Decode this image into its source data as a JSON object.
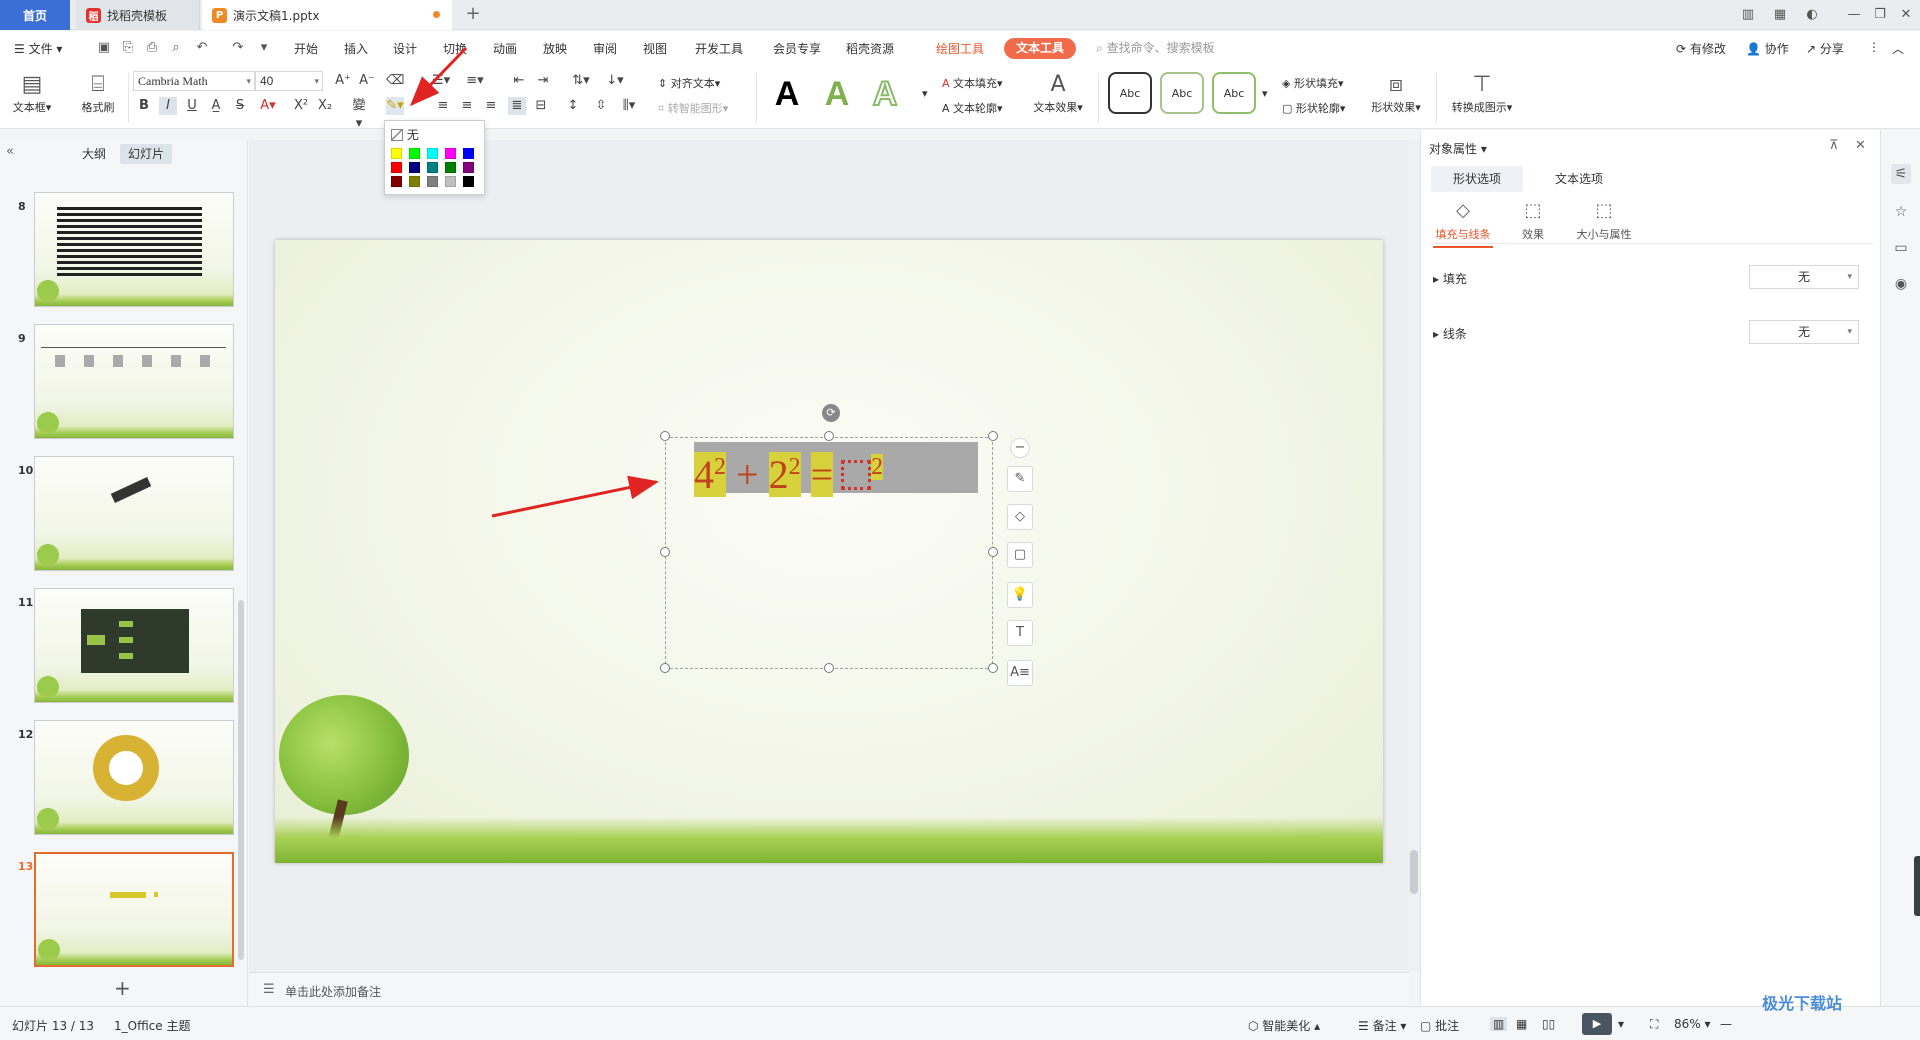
{
  "tabs": {
    "home": "首页",
    "template": "找稻壳模板",
    "doc": "演示文稿1.pptx"
  },
  "menu": {
    "file": "文件",
    "items": [
      "开始",
      "插入",
      "设计",
      "切换",
      "动画",
      "放映",
      "审阅",
      "视图",
      "开发工具",
      "会员专享",
      "稻壳资源"
    ],
    "drawing_tools": "绘图工具",
    "text_tools": "文本工具",
    "search_placeholder": "查找命令、搜索模板",
    "modified": "有修改",
    "collaborate": "协作",
    "share": "分享"
  },
  "ribbon": {
    "textbox": "文本框",
    "format_painter": "格式刷",
    "font_name": "Cambria Math",
    "font_size": "40",
    "align_text": "对齐文本",
    "smart_shape": "转智能图形",
    "text_fill": "文本填充",
    "text_outline": "文本轮廓",
    "text_effect": "文本效果",
    "style_abc": [
      "Abc",
      "Abc",
      "Abc"
    ],
    "shape_fill": "形状填充",
    "shape_outline": "形状轮廓",
    "shape_effect": "形状效果",
    "convert_diagram": "转换成图示"
  },
  "highlight_dropdown": {
    "none_label": "无",
    "colors": [
      "#ffff00",
      "#00ff00",
      "#00ffff",
      "#ff00ff",
      "#0000ff",
      "#ff0000",
      "#000080",
      "#008080",
      "#008000",
      "#800080",
      "#800000",
      "#808000",
      "#808080",
      "#c0c0c0",
      "#000000"
    ]
  },
  "left_panel": {
    "tab_outline": "大纲",
    "tab_slides": "幻灯片",
    "slide_numbers": [
      "8",
      "9",
      "10",
      "11",
      "12",
      "13"
    ],
    "current_slide": "13"
  },
  "slide": {
    "base1": "4",
    "exp1": "2",
    "plus": "+",
    "base2": "2",
    "exp2": "2",
    "equals": "=",
    "exp3": "2"
  },
  "notes_placeholder": "单击此处添加备注",
  "right_panel": {
    "title": "对象属性",
    "tab_shape": "形状选项",
    "tab_text": "文本选项",
    "sub_fill_line": "填充与线条",
    "sub_effect": "效果",
    "sub_size": "大小与属性",
    "fill_label": "填充",
    "fill_value": "无",
    "line_label": "线条",
    "line_value": "无"
  },
  "status": {
    "slide_count": "幻灯片 13 / 13",
    "theme": "1_Office 主题",
    "smart_beautify": "智能美化",
    "notes": "备注",
    "comments": "批注",
    "zoom": "86%"
  },
  "watermark": "极光下载站",
  "colors": {
    "accent_blue": "#3b6fd6",
    "text_tools_pill": "#f06b4a",
    "drawing_tools": "#e8562c"
  }
}
